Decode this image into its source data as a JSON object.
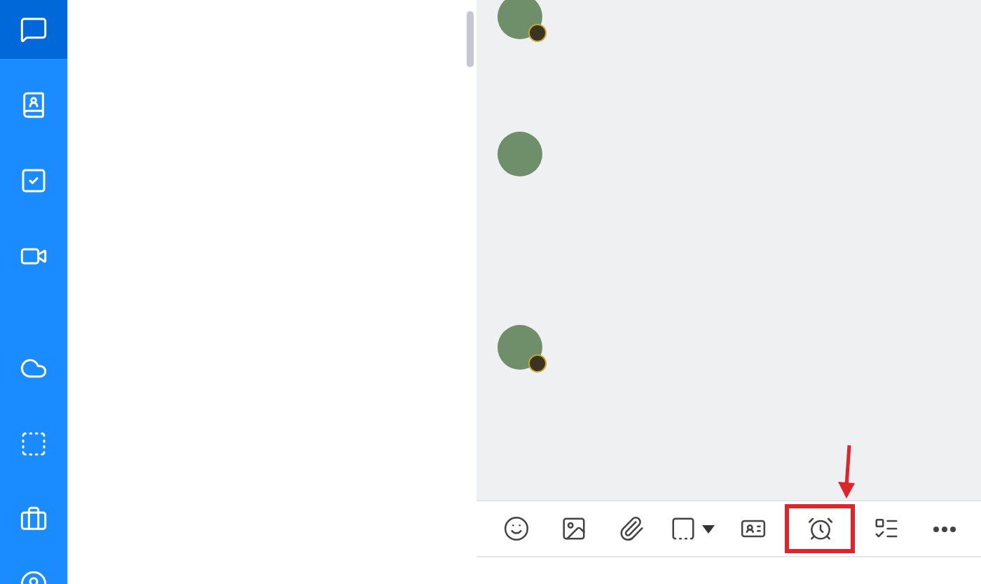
{
  "sidebar": {
    "items": [
      {
        "kind": "chat",
        "selected": true
      },
      {
        "kind": "contacts",
        "selected": false
      },
      {
        "kind": "todo",
        "selected": false
      },
      {
        "kind": "video",
        "selected": false
      },
      {
        "kind": "cloud",
        "selected": false
      },
      {
        "kind": "capture",
        "selected": false
      },
      {
        "kind": "tools",
        "selected": false
      },
      {
        "kind": "more",
        "selected": false
      }
    ]
  },
  "messages": [
    {
      "badge": true
    },
    {
      "badge": false
    },
    {
      "badge": true
    }
  ],
  "toolbar": {
    "items": [
      {
        "kind": "sticker",
        "highlighted": false
      },
      {
        "kind": "image",
        "highlighted": false
      },
      {
        "kind": "attachment",
        "highlighted": false
      },
      {
        "kind": "screenshot",
        "highlighted": false
      },
      {
        "kind": "card",
        "highlighted": false
      },
      {
        "kind": "reminder",
        "highlighted": true
      },
      {
        "kind": "task",
        "highlighted": false
      },
      {
        "kind": "more",
        "highlighted": false
      }
    ]
  }
}
